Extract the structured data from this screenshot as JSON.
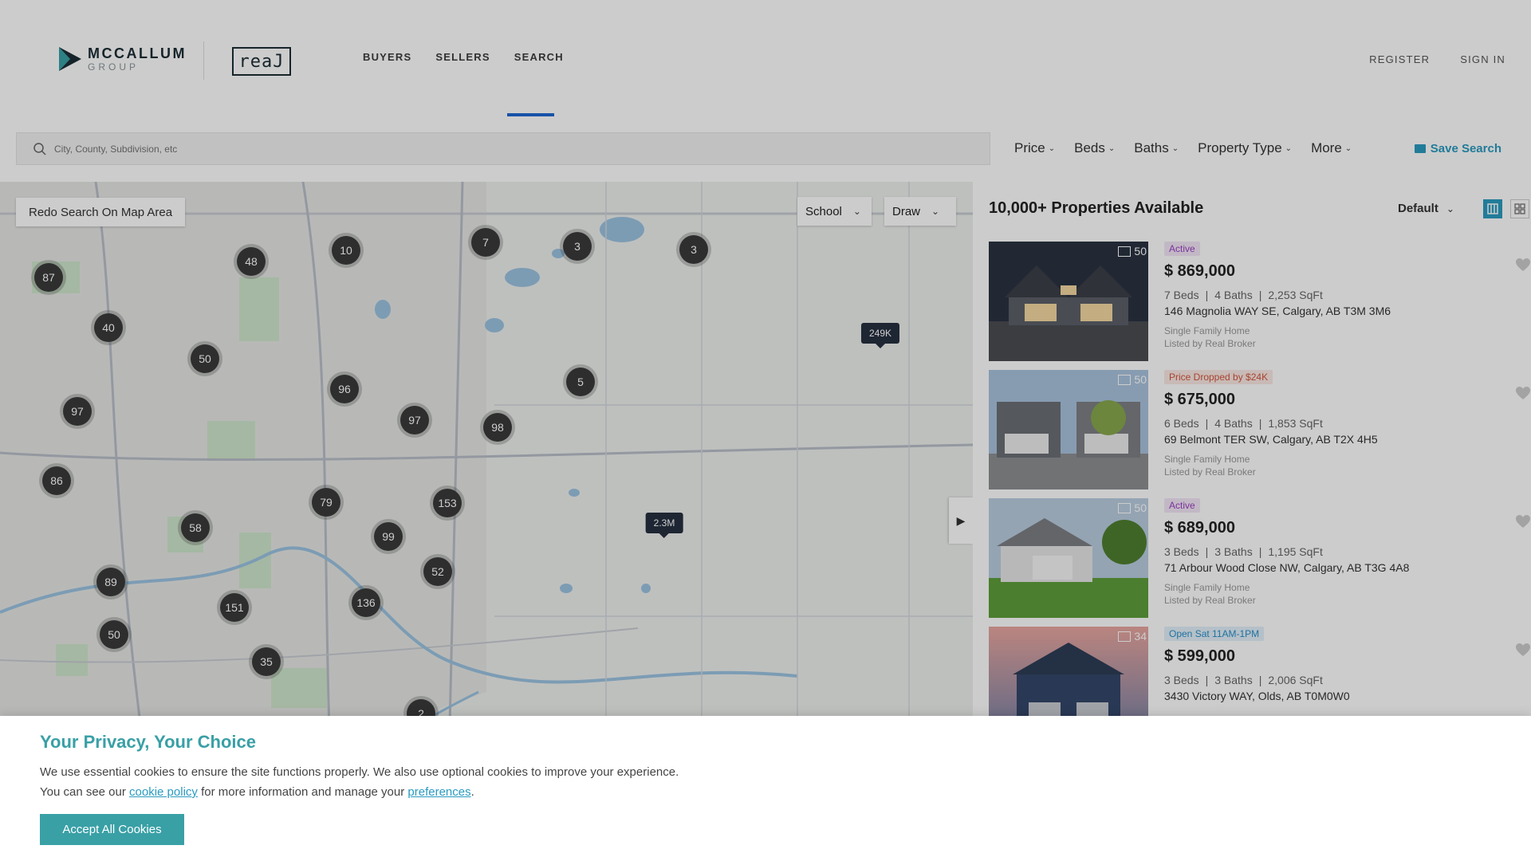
{
  "header": {
    "logo_line1": "MCCALLUM",
    "logo_line2": "GROUP",
    "real_logo": "reaJ",
    "nav": [
      "BUYERS",
      "SELLERS",
      "SEARCH"
    ],
    "register": "REGISTER",
    "sign_in": "SIGN IN"
  },
  "search": {
    "placeholder": "City, County, Subdivision, etc"
  },
  "filters": [
    "Price",
    "Beds",
    "Baths",
    "Property Type",
    "More"
  ],
  "save_search": "Save Search",
  "map": {
    "redo": "Redo Search On Map Area",
    "school": "School",
    "draw": "Draw",
    "clusters": [
      "87",
      "48",
      "10",
      "7",
      "3",
      "3",
      "40",
      "50",
      "96",
      "5",
      "97",
      "97",
      "98",
      "86",
      "79",
      "153",
      "58",
      "99",
      "52",
      "89",
      "151",
      "136",
      "50",
      "35",
      "2"
    ],
    "price_tags": [
      "249K",
      "2.3M"
    ]
  },
  "listings": {
    "count": "10,000+ Properties Available",
    "sort": "Default",
    "items": [
      {
        "badge": "Active",
        "photos": "50",
        "price": "$ 869,000",
        "beds": "7 Beds",
        "baths": "4 Baths",
        "sqft": "2,253 SqFt",
        "address": "146 Magnolia WAY SE, Calgary, AB T3M 3M6",
        "type": "Single Family Home",
        "broker": "Listed by Real Broker"
      },
      {
        "badge": "Price Dropped by $24K",
        "photos": "50",
        "price": "$ 675,000",
        "beds": "6 Beds",
        "baths": "4 Baths",
        "sqft": "1,853 SqFt",
        "address": "69 Belmont TER SW, Calgary, AB T2X 4H5",
        "type": "Single Family Home",
        "broker": "Listed by Real Broker"
      },
      {
        "badge": "Active",
        "photos": "50",
        "price": "$ 689,000",
        "beds": "3 Beds",
        "baths": "3 Baths",
        "sqft": "1,195 SqFt",
        "address": "71 Arbour Wood Close NW, Calgary, AB T3G 4A8",
        "type": "Single Family Home",
        "broker": "Listed by Real Broker"
      },
      {
        "badge": "Open Sat 11AM-1PM",
        "photos": "34",
        "price": "$ 599,000",
        "beds": "3 Beds",
        "baths": "3 Baths",
        "sqft": "2,006 SqFt",
        "address": "3430 Victory WAY, Olds, AB T0M0W0",
        "type": "",
        "broker": ""
      }
    ]
  },
  "cookie": {
    "title": "Your Privacy, Your Choice",
    "line1": "We use essential cookies to ensure the site functions properly. We also use optional cookies to improve your experience.",
    "line2_a": "You can see our ",
    "link1": "cookie policy",
    "line2_b": " for more information and manage your ",
    "link2": "preferences",
    "line2_c": ".",
    "accept": "Accept All Cookies"
  },
  "colors": {
    "accent": "#2a9bc0",
    "teal": "#39a0a6",
    "nav_active": "#1f67d2",
    "cluster": "#3a3a3a"
  }
}
